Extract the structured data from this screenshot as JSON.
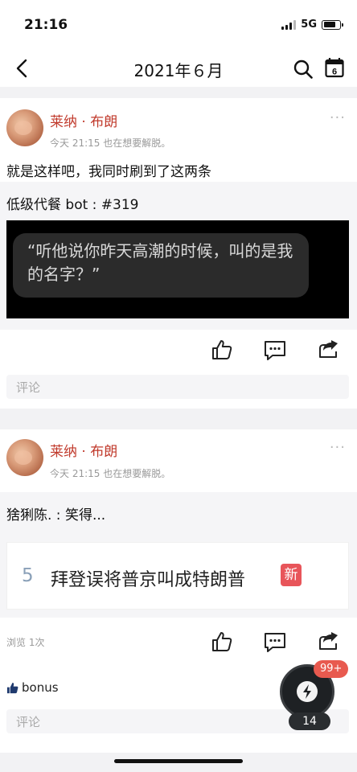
{
  "status": {
    "time": "21:16",
    "network": "5G"
  },
  "nav": {
    "title": "2021年６月",
    "calendar_day": "6"
  },
  "posts": [
    {
      "author": "莱纳 · 布朗",
      "meta": "今天 21:15  也在想要解脱。",
      "body": "就是这样吧，我同时刷到了这两条",
      "repost": "低级代餐 bot : #319",
      "quote": "“听他说你昨天高潮的时候，叫的是我的名字？”",
      "comment_placeholder": "评论"
    },
    {
      "author": "莱纳 · 布朗",
      "meta": "今天 21:15  也在想要解脱。",
      "repost": "猞猁陈. : 笑得...",
      "news": {
        "rank": "5",
        "title": "拜登误将普京叫成特朗普",
        "badge": "新"
      },
      "views": "浏览 1次",
      "bonus": "bonus",
      "comment_placeholder": "评论"
    }
  ],
  "float": {
    "badge": "99+",
    "count": "14"
  }
}
